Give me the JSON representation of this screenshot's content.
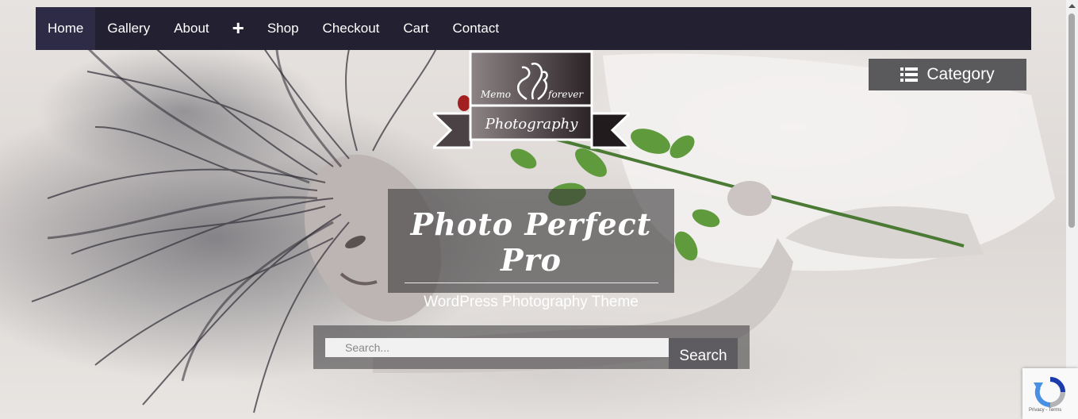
{
  "nav": {
    "items": [
      {
        "label": "Home",
        "active": true
      },
      {
        "label": "Gallery"
      },
      {
        "label": "About"
      },
      {
        "label": "Shop"
      },
      {
        "label": "Checkout"
      },
      {
        "label": "Cart"
      },
      {
        "label": "Contact"
      }
    ],
    "plus_label": "+"
  },
  "logo": {
    "top_left": "Memo",
    "top_right": "forever",
    "banner": "Photography"
  },
  "category": {
    "label": "Category",
    "icon": "list-icon"
  },
  "hero": {
    "title": "Photo Perfect Pro",
    "tagline": "WordPress Photography Theme"
  },
  "search": {
    "placeholder": "Search...",
    "button_label": "Search"
  },
  "recaptcha": {
    "text": "Privacy - Terms",
    "icon": "recaptcha-icon"
  },
  "colors": {
    "nav_bg": "#232131",
    "nav_active_bg": "#2d2b45",
    "category_bg": "#5a595c",
    "rose_leaf": "#5f9a3c"
  }
}
